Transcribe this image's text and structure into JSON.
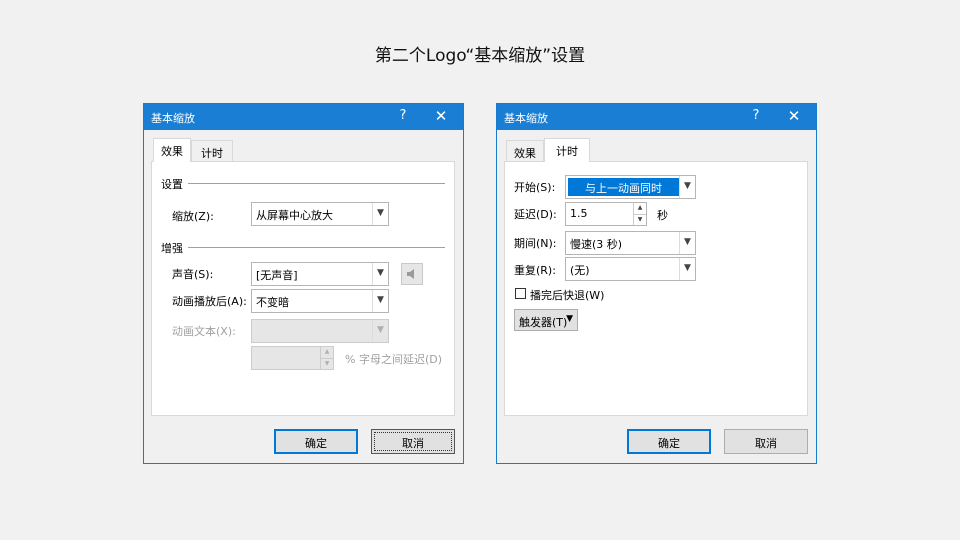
{
  "slide": {
    "title": "第二个Logo“基本缩放”设置"
  },
  "left_dialog": {
    "title": "基本缩放",
    "help": "?",
    "close": "✕",
    "tabs": [
      "效果",
      "计时"
    ],
    "section_settings": "设置",
    "zoom_label": "缩放(Z):",
    "zoom_value": "从屏幕中心放大",
    "section_enhance": "增强",
    "sound_label": "声音(S):",
    "sound_value": "[无声音]",
    "after_anim_label": "动画播放后(A):",
    "after_anim_value": "不变暗",
    "anim_text_label": "动画文本(X):",
    "anim_text_value": "",
    "delay_suffix": "% 字母之间延迟(D)",
    "delay_value": "",
    "ok": "确定",
    "cancel": "取消"
  },
  "right_dialog": {
    "title": "基本缩放",
    "help": "?",
    "close": "✕",
    "tabs": [
      "效果",
      "计时"
    ],
    "start_label": "开始(S):",
    "start_value": "与上一动画同时",
    "delay_label": "延迟(D):",
    "delay_value": "1.5",
    "delay_unit": "秒",
    "duration_label": "期间(N):",
    "duration_value": "慢速(3 秒)",
    "repeat_label": "重复(R):",
    "repeat_value": "(无)",
    "rewind_label": "播完后快退(W)",
    "rewind_checked": false,
    "trigger_label": "触发器(T)",
    "ok": "确定",
    "cancel": "取消"
  }
}
